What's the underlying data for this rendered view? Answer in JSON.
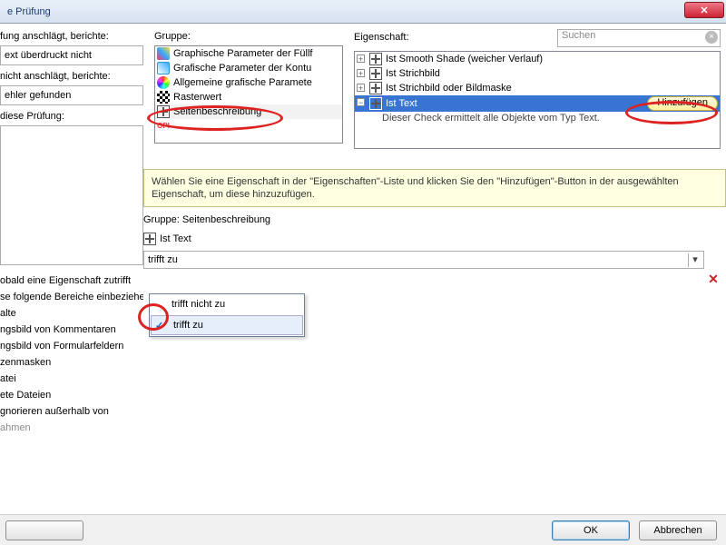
{
  "titlebar": {
    "title": "e Prüfung"
  },
  "left": {
    "l1": "fung anschlägt, berichte:",
    "v1": "ext überdruckt nicht",
    "l2": "nicht anschlägt, berichte:",
    "v2": "ehler gefunden",
    "l3": "diese Prüfung:",
    "items": [
      "obald eine Eigenschaft zutrifft",
      "se folgende Bereiche einbeziehen:",
      "alte",
      "ngsbild von Kommentaren",
      "ngsbild von Formularfeldern",
      "zenmasken",
      "atei",
      "ete Dateien",
      "gnorieren außerhalb von",
      "ahmen"
    ]
  },
  "gruppe": {
    "label": "Gruppe:",
    "rows": [
      "Graphische Parameter der Füllf",
      "Grafische Parameter der Kontu",
      "Allgemeine grafische Paramete",
      "Rasterwert",
      "Seitenbeschreibung",
      "OPI"
    ]
  },
  "eig": {
    "label": "Eigenschaft:",
    "search_ph": "Suchen",
    "rows": [
      "Ist Smooth Shade (weicher Verlauf)",
      "Ist Strichbild",
      "Ist Strichbild oder Bildmaske",
      "Ist Text"
    ],
    "desc": "Dieser Check ermittelt alle Objekte vom Typ Text.",
    "add": "Hinzufügen"
  },
  "hint": "Wählen Sie eine Eigenschaft in der \"Eigenschaften\"-Liste und klicken Sie den \"Hinzufügen\"-Button in der ausgewählten Eigenschaft, um diese hinzuzufügen.",
  "selgroup_lbl": "Gruppe:",
  "selgroup_val": "Seitenbeschreibung",
  "selprop": "Ist Text",
  "combo": "trifft zu",
  "dd": {
    "opt1": "trifft nicht zu",
    "opt2": "trifft zu"
  },
  "buttons": {
    "ok": "OK",
    "cancel": "Abbrechen",
    "left": ""
  }
}
